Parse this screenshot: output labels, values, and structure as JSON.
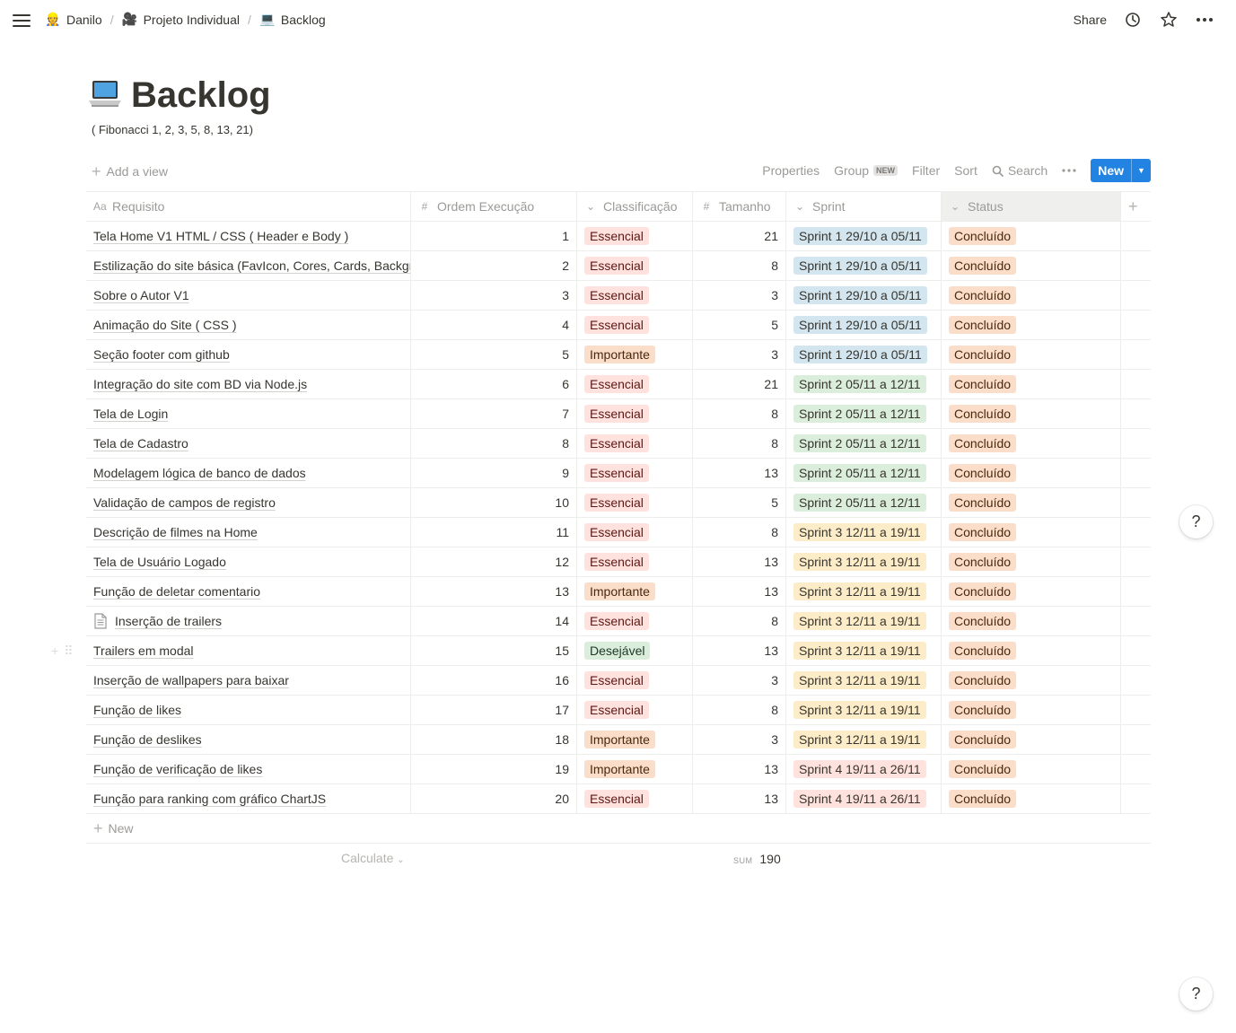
{
  "breadcrumb": [
    {
      "emoji": "👷",
      "label": "Danilo"
    },
    {
      "emoji": "🎥",
      "label": "Projeto Individual"
    },
    {
      "emoji": "💻",
      "label": "Backlog"
    }
  ],
  "topbar": {
    "share": "Share"
  },
  "page": {
    "title": "Backlog",
    "subtitle": "( Fibonacci 1, 2, 3, 5, 8, 13, 21)"
  },
  "viewbar": {
    "add_view": "Add a view",
    "properties": "Properties",
    "group": "Group",
    "group_badge": "NEW",
    "filter": "Filter",
    "sort": "Sort",
    "search": "Search",
    "new": "New"
  },
  "columns": [
    "Requisito",
    "Ordem Execução",
    "Classificação",
    "Tamanho",
    "Sprint",
    "Status"
  ],
  "colors": {
    "essencial": "#ffe2dd",
    "essencial_text": "#5d1715",
    "importante": "#fadec9",
    "importante_text": "#49290e",
    "desejavel": "#dbeddb",
    "desejavel_text": "#1c3829",
    "sprint1": "#d3e5ef",
    "sprint2": "#dbeddb",
    "sprint3": "#fdecc8",
    "sprint4": "#ffe2dd",
    "status": "#fadec9",
    "accent": "#2383e2"
  },
  "rows": [
    {
      "req": "Tela Home V1 HTML / CSS ( Header e Body )",
      "ordem": "1",
      "class": "Essencial",
      "tam": "21",
      "sprint": "Sprint 1 29/10 a 05/11",
      "status": "Concluído"
    },
    {
      "req": "Estilização do site básica (FavIcon, Cores, Cards, Background)",
      "ordem": "2",
      "class": "Essencial",
      "tam": "8",
      "sprint": "Sprint 1 29/10 a 05/11",
      "status": "Concluído"
    },
    {
      "req": "Sobre o Autor V1",
      "ordem": "3",
      "class": "Essencial",
      "tam": "3",
      "sprint": "Sprint 1 29/10 a 05/11",
      "status": "Concluído"
    },
    {
      "req": "Animação do Site ( CSS )",
      "ordem": "4",
      "class": "Essencial",
      "tam": "5",
      "sprint": "Sprint 1 29/10 a 05/11",
      "status": "Concluído"
    },
    {
      "req": "Seção footer com github",
      "ordem": "5",
      "class": "Importante",
      "tam": "3",
      "sprint": "Sprint 1 29/10 a 05/11",
      "status": "Concluído"
    },
    {
      "req": "Integração do site com BD via Node.js",
      "ordem": "6",
      "class": "Essencial",
      "tam": "21",
      "sprint": "Sprint 2 05/11 a 12/11",
      "status": "Concluído"
    },
    {
      "req": "Tela de Login",
      "ordem": "7",
      "class": "Essencial",
      "tam": "8",
      "sprint": "Sprint 2 05/11 a 12/11",
      "status": "Concluído"
    },
    {
      "req": "Tela de Cadastro",
      "ordem": "8",
      "class": "Essencial",
      "tam": "8",
      "sprint": "Sprint 2 05/11 a 12/11",
      "status": "Concluído"
    },
    {
      "req": "Modelagem lógica de banco de dados",
      "ordem": "9",
      "class": "Essencial",
      "tam": "13",
      "sprint": "Sprint 2 05/11 a 12/11",
      "status": "Concluído"
    },
    {
      "req": "Validação de campos de registro",
      "ordem": "10",
      "class": "Essencial",
      "tam": "5",
      "sprint": "Sprint 2 05/11 a 12/11",
      "status": "Concluído"
    },
    {
      "req": "Descrição de filmes na Home",
      "ordem": "11",
      "class": "Essencial",
      "tam": "8",
      "sprint": "Sprint 3 12/11 a 19/11",
      "status": "Concluído"
    },
    {
      "req": "Tela de Usuário Logado",
      "ordem": "12",
      "class": "Essencial",
      "tam": "13",
      "sprint": "Sprint 3 12/11 a 19/11",
      "status": "Concluído"
    },
    {
      "req": "Função de deletar comentario",
      "ordem": "13",
      "class": "Importante",
      "tam": "13",
      "sprint": "Sprint 3 12/11 a 19/11",
      "status": "Concluído"
    },
    {
      "req": "Inserção de trailers",
      "ordem": "14",
      "class": "Essencial",
      "tam": "8",
      "sprint": "Sprint 3 12/11 a 19/11",
      "status": "Concluído",
      "doc": true
    },
    {
      "req": "Trailers em modal",
      "ordem": "15",
      "class": "Desejável",
      "tam": "13",
      "sprint": "Sprint 3 12/11 a 19/11",
      "status": "Concluído"
    },
    {
      "req": "Inserção de wallpapers para baixar",
      "ordem": "16",
      "class": "Essencial",
      "tam": "3",
      "sprint": "Sprint 3 12/11 a 19/11",
      "status": "Concluído"
    },
    {
      "req": "Função de likes",
      "ordem": "17",
      "class": "Essencial",
      "tam": "8",
      "sprint": "Sprint 3 12/11 a 19/11",
      "status": "Concluído"
    },
    {
      "req": "Função de deslikes",
      "ordem": "18",
      "class": "Importante",
      "tam": "3",
      "sprint": "Sprint 3 12/11 a 19/11",
      "status": "Concluído"
    },
    {
      "req": "Função de verificação de likes",
      "ordem": "19",
      "class": "Importante",
      "tam": "13",
      "sprint": "Sprint 4 19/11 a 26/11",
      "status": "Concluído"
    },
    {
      "req": "Função para ranking com gráfico ChartJS",
      "ordem": "20",
      "class": "Essencial",
      "tam": "13",
      "sprint": "Sprint 4 19/11 a 26/11",
      "status": "Concluído"
    }
  ],
  "footer": {
    "new_row": "New",
    "calculate": "Calculate",
    "sum_label": "SUM",
    "sum_value": "190"
  },
  "help": "?"
}
